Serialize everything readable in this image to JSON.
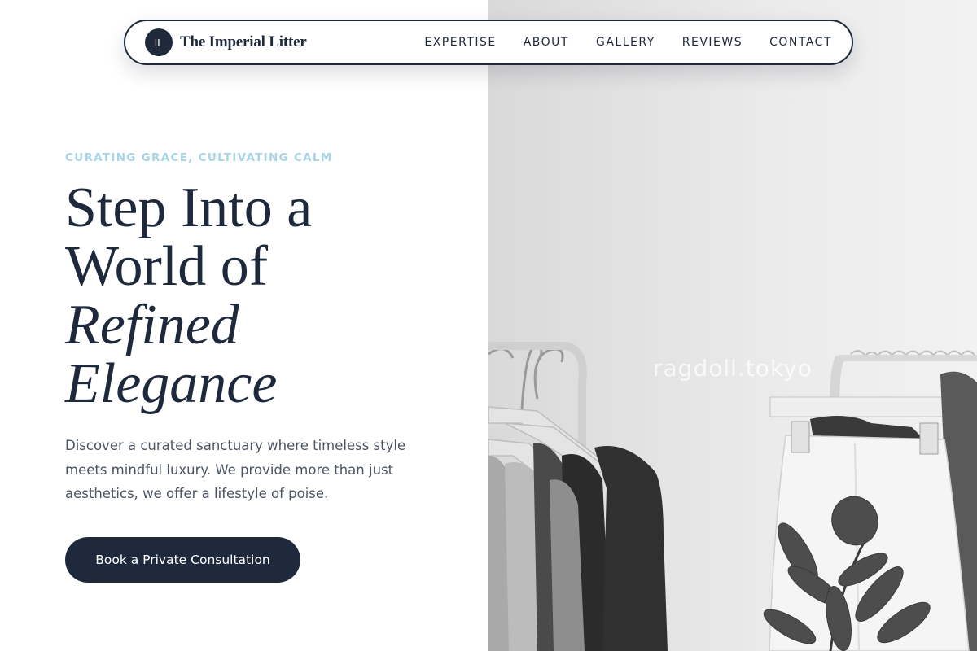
{
  "brand": {
    "logo_initials": "IL",
    "name": "The Imperial Litter"
  },
  "nav": {
    "links": [
      "EXPERTISE",
      "ABOUT",
      "GALLERY",
      "REVIEWS",
      "CONTACT"
    ]
  },
  "hero": {
    "eyebrow": "CURATING GRACE, CULTIVATING CALM",
    "headline_lines": [
      "Step Into a",
      "World of",
      "Refined",
      "Elegance"
    ],
    "description": "Discover a curated sanctuary where timeless style meets mindful luxury. We provide more than just aesthetics, we offer a lifestyle of poise.",
    "cta_label": "Book a Private Consultation"
  },
  "photo": {
    "watermark": "ragdoll.tokyo",
    "subject": "clothing-racks-with-plant"
  },
  "colors": {
    "primary": "#1e293b",
    "accent": "#a8d5e4",
    "body_text": "#4b5563",
    "background": "#ffffff"
  }
}
